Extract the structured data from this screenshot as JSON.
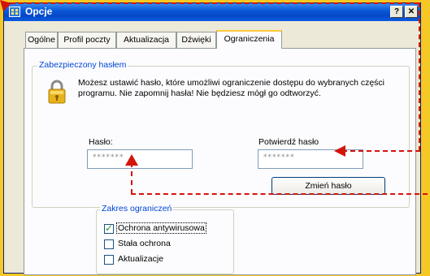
{
  "window": {
    "title": "Opcje"
  },
  "titlebar": {
    "help_label": "?",
    "close_label": "✕"
  },
  "tabs": [
    {
      "label": "Ogólne"
    },
    {
      "label": "Profil poczty"
    },
    {
      "label": "Aktualizacja"
    },
    {
      "label": "Dźwięki"
    },
    {
      "label": "Ograniczenia"
    }
  ],
  "active_tab": "Ograniczenia",
  "password_group": {
    "title": "Zabezpieczony hasłem",
    "description": "Możesz ustawić hasło, które umożliwi ograniczenie dostępu do wybranych części programu. Nie zapomnij hasła! Nie będziesz mógł go odtworzyć.",
    "password_label": "Hasło:",
    "password_value": "*******",
    "confirm_label": "Potwierdź hasło",
    "confirm_value": "*******",
    "change_button": "Zmień hasło"
  },
  "scope_group": {
    "title": "Zakres ograniczeń",
    "items": [
      {
        "label": "Ochrona antywirusowa",
        "checked": true
      },
      {
        "label": "Stała ochrona",
        "checked": false
      },
      {
        "label": "Aktualizacje",
        "checked": false
      }
    ]
  },
  "colors": {
    "annotation": "#d3140c",
    "background": "#f6c825",
    "title_blue": "#0a58d8"
  }
}
